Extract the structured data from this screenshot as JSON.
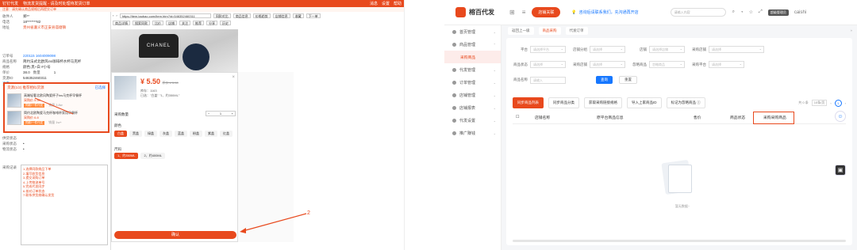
{
  "left": {
    "titlebar": {
      "app": "钉钉代发",
      "notice": "物流发货提醒 - 请及时处理待发货订单",
      "right_items": [
        "消息",
        "设置",
        "帮助"
      ]
    },
    "notice_text": "注意：请先确认商品规格后再提交订单",
    "order": {
      "rows": [
        {
          "k": "收件人",
          "v": "郑**"
        },
        {
          "k": "电话",
          "v": "18*******82"
        },
        {
          "k": "地址",
          "v": "贵州省遵义市正安县庙塘镇",
          "red": true
        }
      ],
      "order_no_label": "订单号",
      "order_no": "220115 1604009098",
      "product_label": "商品名称",
      "product": "简约法式北欧风ins咖啡杯水杯马克杯",
      "spec_label": "规格",
      "spec": "颜色:黑+白 #小号",
      "price_label": "单价",
      "price": "38.0",
      "qty_label": "数量",
      "qty": "1",
      "source_label": "货源ID",
      "source": "546352460311",
      "view_label": "查看"
    },
    "box": {
      "title": "货源(1/2) 推荐相似货源",
      "link": "已选择",
      "items": [
        {
          "title": "高端轻奢北欧风陶瓷杯子ins马克杯早餐杯",
          "price": "采购价 5.50",
          "tag": "同款/一件代发",
          "stat": "销量 3.8w"
        },
        {
          "title": "简约北欧陶瓷马克杯咖啡杯家用早餐杯",
          "price": "采购价 6.8",
          "tag": "同款/一件代发",
          "stat": "销量 1w+"
        }
      ]
    },
    "status": [
      {
        "k": "供货状态",
        "v": ""
      },
      {
        "k": "采购状态",
        "v": "•"
      },
      {
        "k": "物流状态",
        "v": "•"
      }
    ],
    "notes_label": "采购记录",
    "notes": [
      "1.选择同款商品下单",
      "2.填写收货信息",
      "3.提交采购订单",
      "4.上传物流单号",
      "5.完成代发同步",
      "6.核对订单状态",
      "7.联系供货商确认发货"
    ],
    "browser": {
      "url": "https://item.taobao.com/item.htm?id=546352460311",
      "buttons": [
        "同款对比",
        "商品信息",
        "价格趋势",
        "店铺信息",
        "收藏",
        "下一单"
      ],
      "buttons2": [
        "商品详情",
        "搜索同款",
        "比价",
        "店铺",
        "关注",
        "推荐",
        "分享",
        "历史"
      ],
      "photo_brand": "CHANEL"
    },
    "sku": {
      "price": "¥ 5.50",
      "orig": "原价 ¥ 5.50",
      "meta1": "库存：1163",
      "meta2": "已选：\"白盖\" \"1、约350ML\"",
      "qty_label": "采购数量",
      "qty": "1",
      "color_label": "颜色",
      "colors": [
        "白盖",
        "黑盖",
        "绿盖",
        "灰盖",
        "蓝盖",
        "粉盖",
        "紫盖",
        "红盖"
      ],
      "size_label": "尺码",
      "sizes": [
        "1、约350ML",
        "2、约400ML"
      ],
      "confirm": "确认"
    },
    "annotation_number": "2"
  },
  "right": {
    "brand": "榕百代发",
    "shop_button": "店铺关联",
    "promo": "咨询后请联系我们，先沟通再开店",
    "search_placeholder": "请输入内容",
    "user_tag": "超级管理员",
    "user_name": "caishi",
    "sidebar": [
      {
        "label": "首页管理",
        "active": false,
        "sub": false
      },
      {
        "label": "商品管理",
        "active": false,
        "sub": false
      },
      {
        "label": "采购商品",
        "active": true,
        "sub": true
      },
      {
        "label": "代发管理",
        "active": false,
        "sub": false
      },
      {
        "label": "订单管理",
        "active": false,
        "sub": false
      },
      {
        "label": "店铺管理",
        "active": false,
        "sub": false
      },
      {
        "label": "店铺报表",
        "active": false,
        "sub": false
      },
      {
        "label": "代发设置",
        "active": false,
        "sub": false
      },
      {
        "label": "推广赚钱",
        "active": false,
        "sub": false
      }
    ],
    "tabs": [
      "返回上一级",
      "商品采购",
      "代发订单"
    ],
    "filters_row1": [
      {
        "k": "平台",
        "v": "请选择平台"
      },
      {
        "k": "店铺分组",
        "v": "请选择"
      },
      {
        "k": "店铺",
        "v": "请选择店铺"
      },
      {
        "k": "采购店铺",
        "v": "请选择"
      }
    ],
    "filters_row2": [
      {
        "k": "商品状态",
        "v": "请选择"
      },
      {
        "k": "采购店铺",
        "v": "请选择"
      },
      {
        "k": "忽略商品",
        "v": "忽略商品"
      },
      {
        "k": "采购平台",
        "v": "请选择"
      }
    ],
    "filters_row3": [
      {
        "k": "商品名称",
        "v": "请输入"
      }
    ],
    "query_button": "查询",
    "reset_button": "重置",
    "actions": [
      "同步商品列表",
      "同步商品分类",
      "获取采购链接规格",
      "导入上家商品ID",
      "标记为忽略商品 ⓘ"
    ],
    "pager": {
      "total": "共 0 条",
      "size": "10条/页",
      "page": "1"
    },
    "columns": [
      "店铺名称",
      "原平台商品信息",
      "售价",
      "商品状态",
      "采购采购商品"
    ],
    "empty_text": "暂无数据~"
  }
}
